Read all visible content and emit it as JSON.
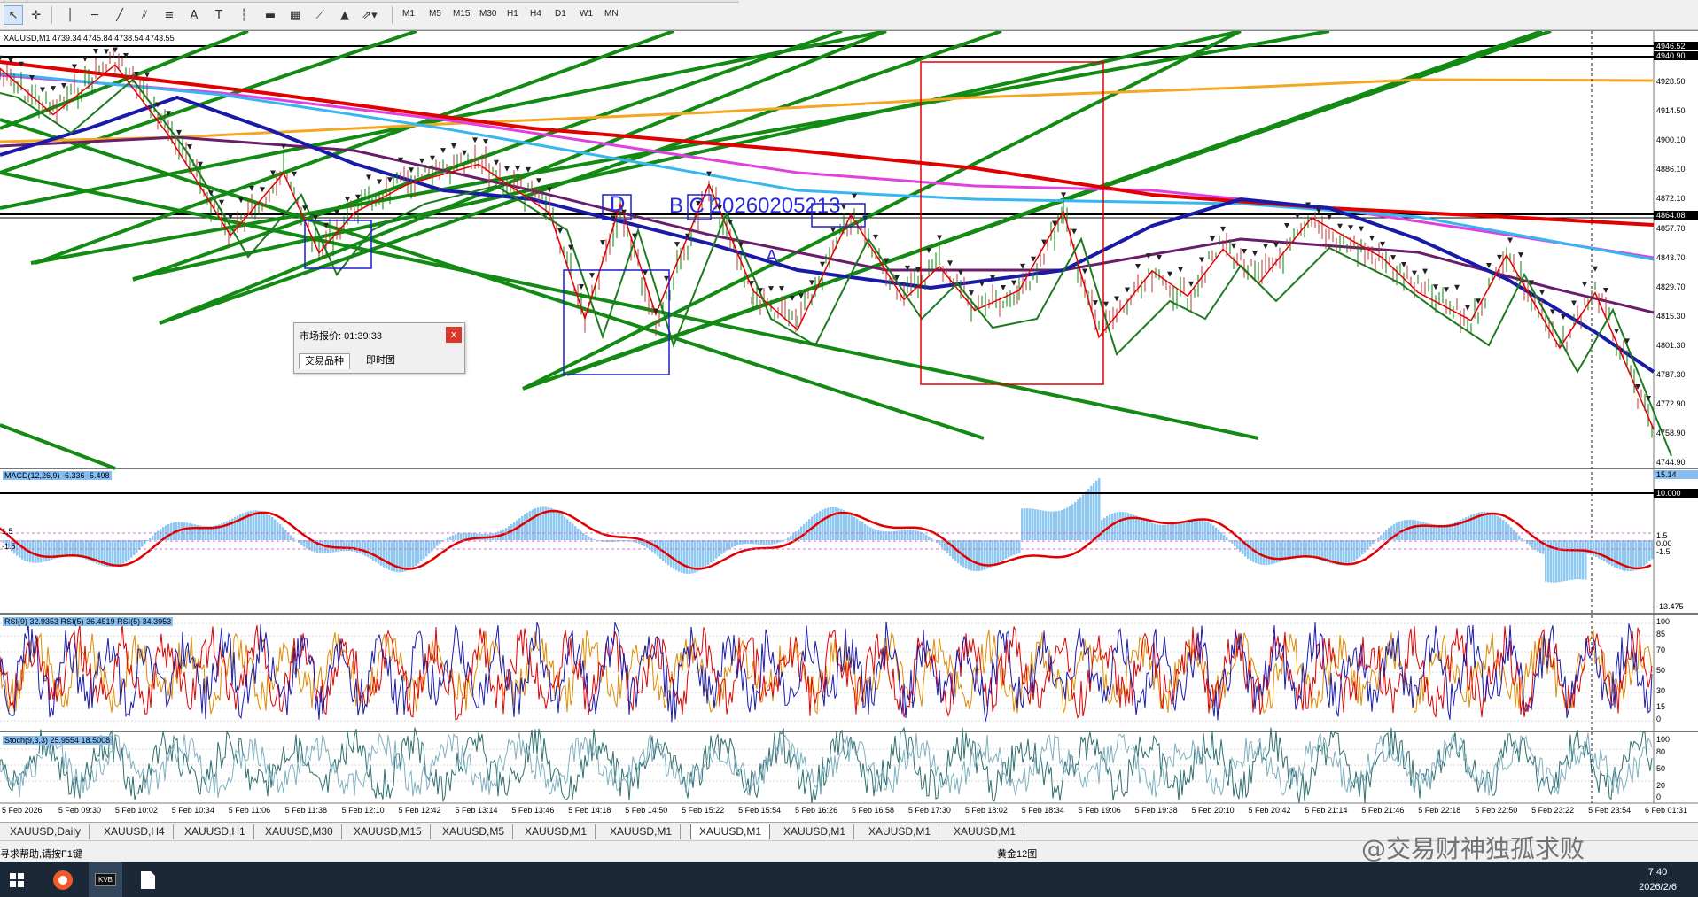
{
  "toolbar": {
    "timeframes": [
      "M1",
      "M5",
      "M15",
      "M30",
      "H1",
      "H4",
      "D1",
      "W1",
      "MN"
    ]
  },
  "chart": {
    "title": "XAUUSD,M1  4739.34 4745.84 4738.54 4743.55",
    "price_axis": [
      "4928.50",
      "4914.50",
      "4900.10",
      "4886.10",
      "4872.10",
      "4857.70",
      "4843.70",
      "4829.70",
      "4815.30",
      "4801.30",
      "4787.30",
      "4772.90",
      "4758.90",
      "4744.90"
    ],
    "price_tags": [
      "4946.52",
      "4940.90",
      "4864.08"
    ],
    "annotation": "B C 20260205213",
    "annotation_d": "D",
    "annotation_a": "A",
    "colors": {
      "up": "#008000",
      "ma_red": "#e00000",
      "ma_blue": "#1a1aa8",
      "ma_purple": "#6a1d6a",
      "ma_orange": "#f5a623",
      "ma_magenta": "#e040e0",
      "ma_cyan": "#37b6f0",
      "channel": "#138a13"
    }
  },
  "macd": {
    "label": "MACD(12,26,9) -6.336 -5.498",
    "axis_top": "15.14",
    "axis_level": "10.000",
    "axis_p15": "1.5",
    "axis_zero": "0.00",
    "axis_m15": "-1.5",
    "axis_bottom": "-13.475",
    "left_p15": "1.5",
    "left_m15": "-1.5"
  },
  "rsi": {
    "label": "RSI(9) 32.9353  RSI(5) 36.4519  RSI(5) 34.3953",
    "levels": [
      "100",
      "85",
      "70",
      "50",
      "30",
      "15",
      "0"
    ]
  },
  "stoch": {
    "label": "Stoch(9,3,3) 25.9554 18.5008",
    "levels": [
      "100",
      "80",
      "50",
      "20",
      "0"
    ]
  },
  "time_axis": [
    "5 Feb 2026",
    "5 Feb 09:30",
    "5 Feb 10:02",
    "5 Feb 10:34",
    "5 Feb 11:06",
    "5 Feb 11:38",
    "5 Feb 12:10",
    "5 Feb 12:42",
    "5 Feb 13:14",
    "5 Feb 13:46",
    "5 Feb 14:18",
    "5 Feb 14:50",
    "5 Feb 15:22",
    "5 Feb 15:54",
    "5 Feb 16:26",
    "5 Feb 16:58",
    "5 Feb 17:30",
    "5 Feb 18:02",
    "5 Feb 18:34",
    "5 Feb 19:06",
    "5 Feb 19:38",
    "5 Feb 20:10",
    "5 Feb 20:42",
    "5 Feb 21:14",
    "5 Feb 21:46",
    "5 Feb 22:18",
    "5 Feb 22:50",
    "5 Feb 23:22",
    "5 Feb 23:54",
    "6 Feb 01:31"
  ],
  "market_window": {
    "title": "市场报价: 01:39:33",
    "close": "x",
    "tab1": "交易品种",
    "tab2": "即时图"
  },
  "chart_tabs": [
    "XAUUSD,Daily",
    "XAUUSD,H4",
    "XAUUSD,H1",
    "XAUUSD,M30",
    "XAUUSD,M15",
    "XAUUSD,M5",
    "XAUUSD,M1",
    "XAUUSD,M1",
    "XAUUSD,M1",
    "XAUUSD,M1",
    "XAUUSD,M1",
    "XAUUSD,M1"
  ],
  "statusbar": {
    "help": "寻求帮助,请按F1键",
    "profile": "黄金12图",
    "watermark": "@交易财神独孤求败"
  },
  "taskbar": {
    "app_label": "KVB",
    "time": "7:40",
    "date": "2026/2/6"
  }
}
